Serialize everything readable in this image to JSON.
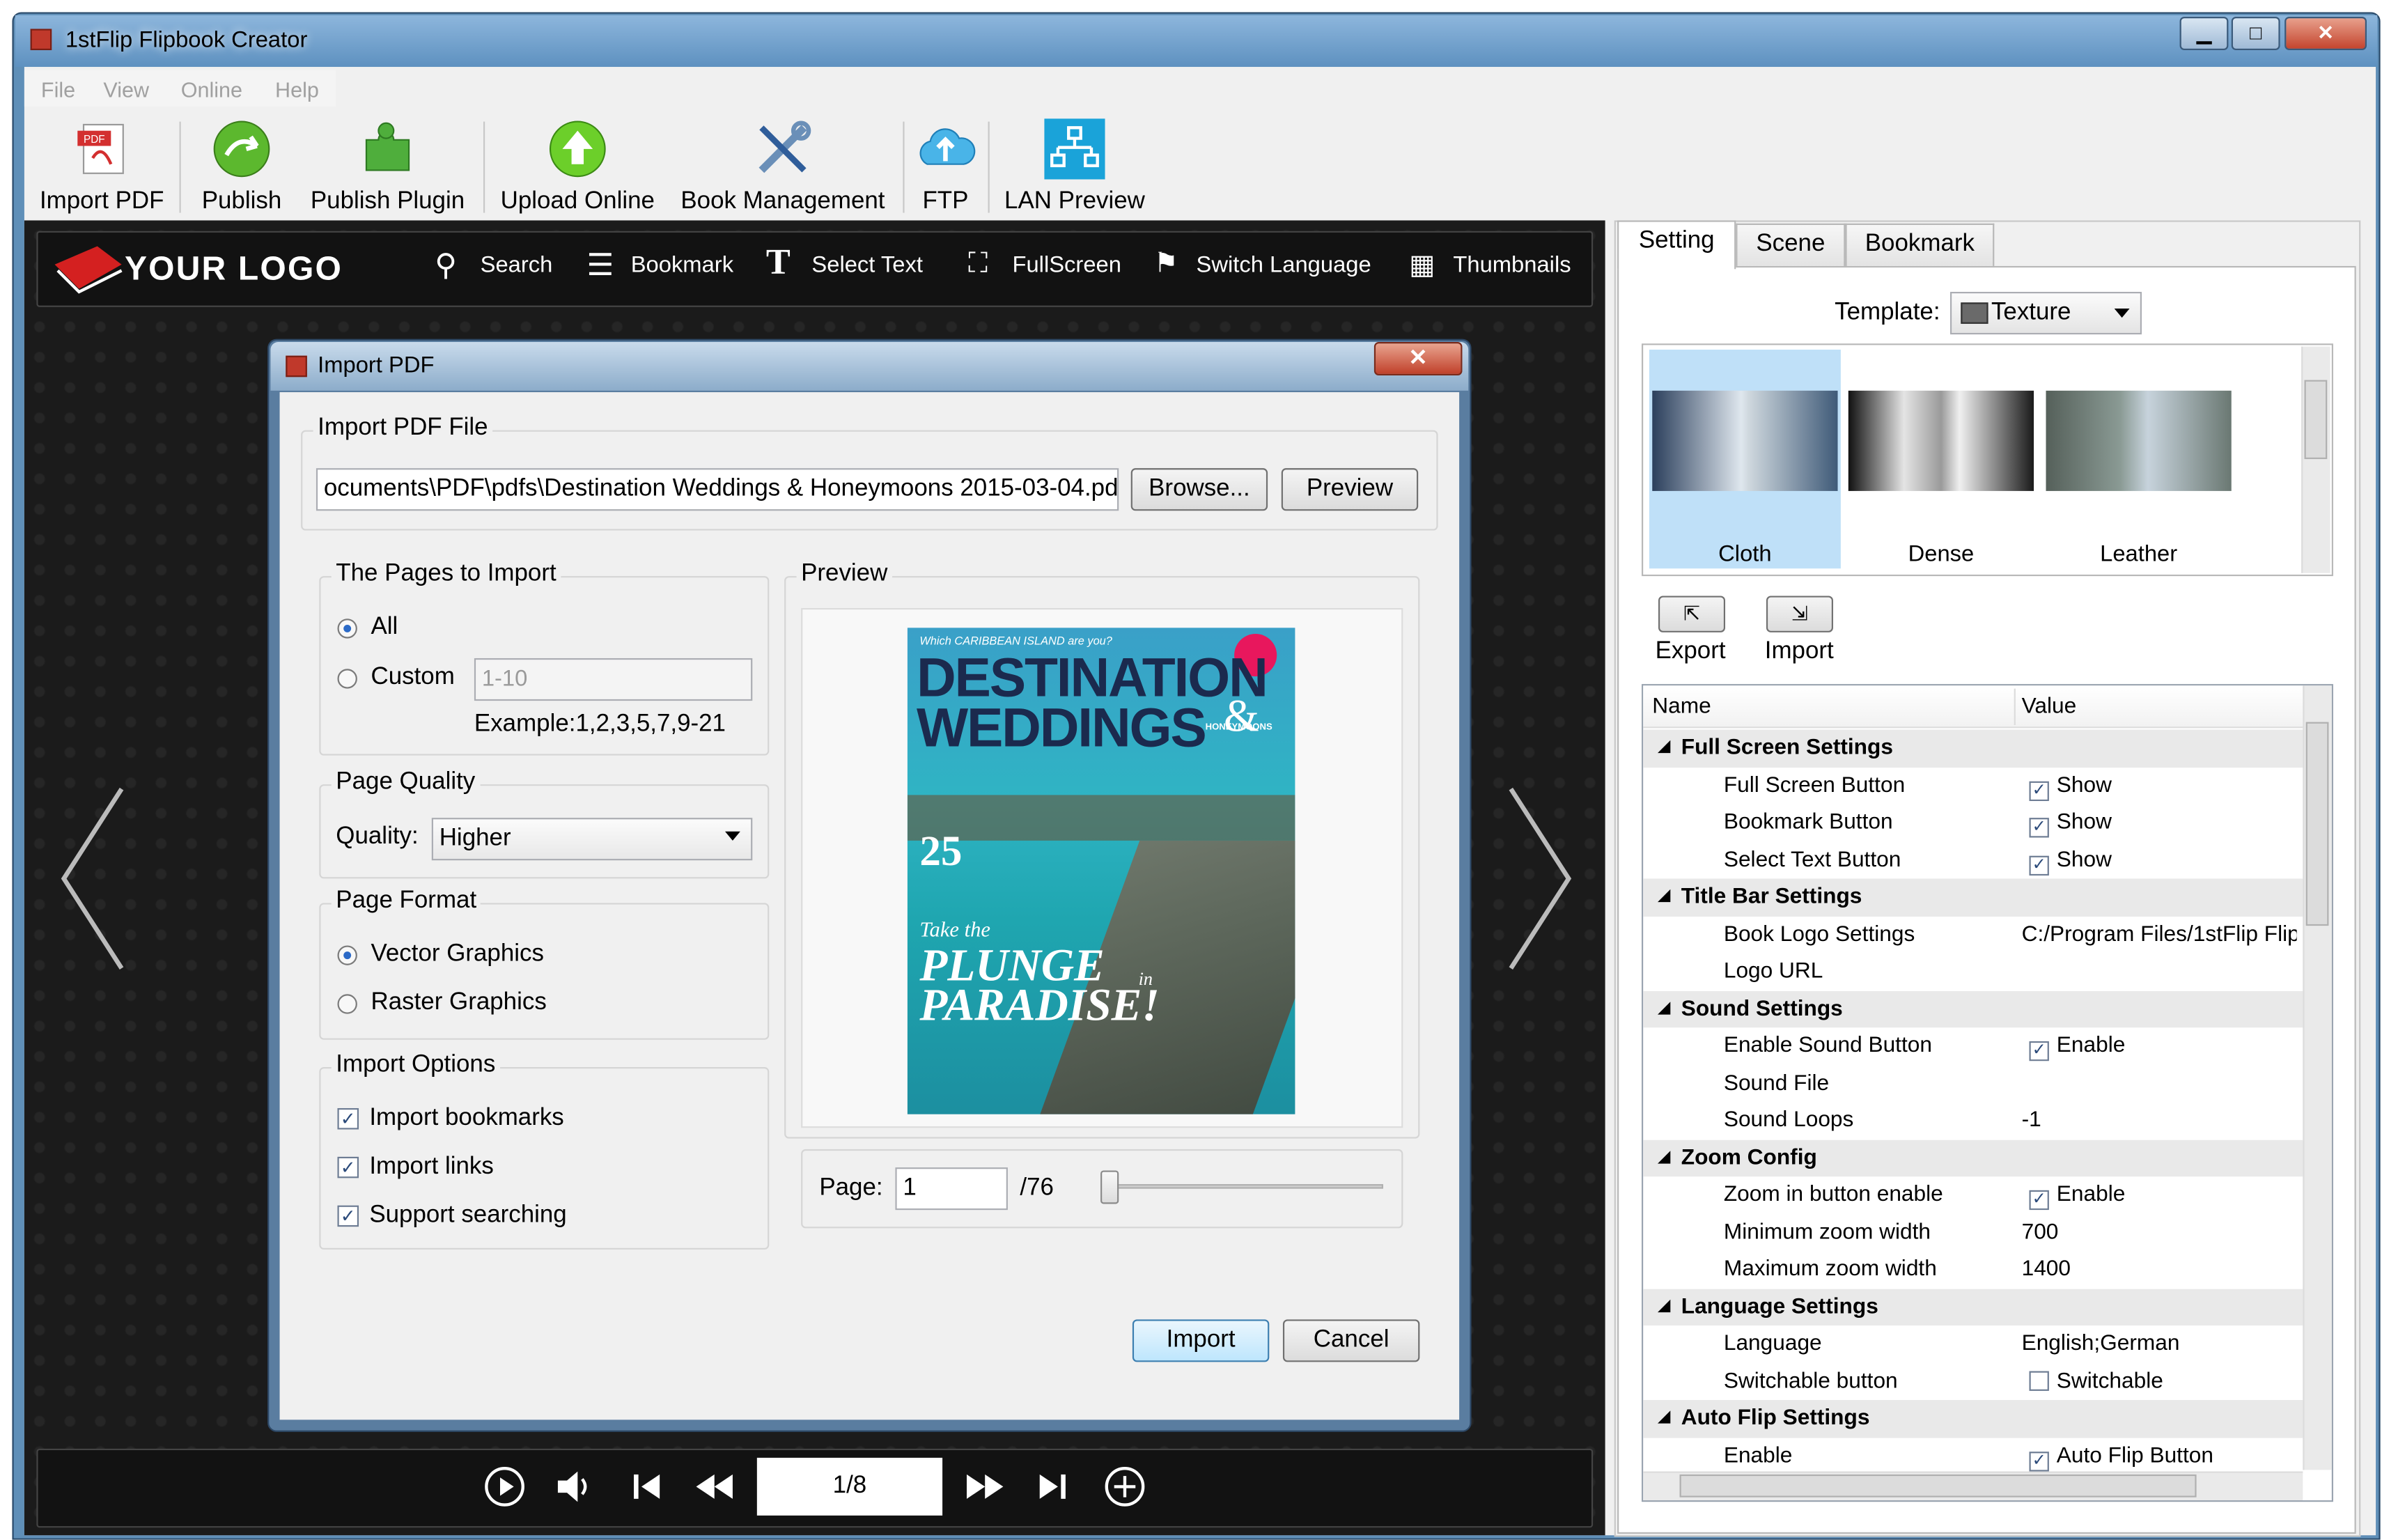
{
  "window": {
    "title": "1stFlip Flipbook Creator",
    "min": "▁",
    "max": "□",
    "close": "✕"
  },
  "menu": [
    "File",
    "View",
    "Online",
    "Help"
  ],
  "toolbar": [
    {
      "label": "Import PDF",
      "icon": "pdf-icon"
    },
    {
      "label": "Publish",
      "icon": "publish-icon"
    },
    {
      "label": "Publish Plugin",
      "icon": "plugin-icon"
    },
    {
      "label": "Upload Online",
      "icon": "upload-icon"
    },
    {
      "label": "Book Management",
      "icon": "tools-icon"
    },
    {
      "label": "FTP",
      "icon": "cloud-icon"
    },
    {
      "label": "LAN Preview",
      "icon": "network-icon"
    }
  ],
  "book_toolbar": {
    "logo": "YOUR LOGO",
    "items": [
      "Search",
      "Bookmark",
      "Select Text",
      "FullScreen",
      "Switch Language",
      "Thumbnails"
    ]
  },
  "book_bottom": {
    "page": "1/8"
  },
  "dialog": {
    "title": "Import PDF",
    "close": "✕",
    "file_group": "Import PDF File",
    "file_path": "ocuments\\PDF\\pdfs\\Destination Weddings & Honeymoons 2015-03-04.pdf",
    "browse": "Browse...",
    "preview_btn": "Preview",
    "pages_group": "The Pages to Import",
    "all": "All",
    "custom": "Custom",
    "custom_value": "1-10",
    "example": "Example:1,2,3,5,7,9-21",
    "quality_group": "Page Quality",
    "quality_label": "Quality:",
    "quality_value": "Higher",
    "format_group": "Page Format",
    "vector": "Vector Graphics",
    "raster": "Raster Graphics",
    "options_group": "Import Options",
    "opt_bookmarks": "Import bookmarks",
    "opt_links": "Import links",
    "opt_search": "Support searching",
    "preview_group": "Preview",
    "cover": {
      "top": "Which CARIBBEAN ISLAND are you?",
      "line1": "DESTINATION",
      "line2": "WEDDINGS",
      "amp": "&",
      "honey": "HONEYMOONS",
      "num": "25",
      "take": "Take the",
      "plunge": "PLUNGE",
      "in": "in",
      "paradise": "PARADISE!"
    },
    "page_label": "Page:",
    "page_value": "1",
    "page_total": "/76",
    "import": "Import",
    "cancel": "Cancel"
  },
  "panel": {
    "tabs": [
      "Setting",
      "Scene",
      "Bookmark"
    ],
    "template_label": "Template:",
    "template_value": "Texture",
    "thumbs": [
      "Cloth",
      "Dense",
      "Leather"
    ],
    "export": "Export",
    "import": "Import",
    "col_name": "Name",
    "col_value": "Value",
    "rows": [
      {
        "cat": true,
        "name": "Full Screen Settings"
      },
      {
        "name": "Full Screen Button",
        "check": true,
        "value": "Show"
      },
      {
        "name": "Bookmark Button",
        "check": true,
        "value": "Show"
      },
      {
        "name": "Select Text Button",
        "check": true,
        "value": "Show"
      },
      {
        "cat": true,
        "name": "Title Bar Settings"
      },
      {
        "name": "Book Logo Settings",
        "value": "C:/Program Files/1stFlip Flip"
      },
      {
        "name": "Logo URL",
        "value": ""
      },
      {
        "cat": true,
        "name": "Sound Settings"
      },
      {
        "name": "Enable Sound Button",
        "check": true,
        "value": "Enable"
      },
      {
        "name": "Sound File",
        "value": ""
      },
      {
        "name": "Sound Loops",
        "value": "-1"
      },
      {
        "cat": true,
        "name": "Zoom Config"
      },
      {
        "name": "Zoom in button enable",
        "check": true,
        "value": "Enable"
      },
      {
        "name": "Minimum zoom width",
        "value": "700"
      },
      {
        "name": "Maximum zoom width",
        "value": "1400"
      },
      {
        "cat": true,
        "name": "Language Settings"
      },
      {
        "name": "Language",
        "value": "English;German"
      },
      {
        "name": "Switchable button",
        "check": false,
        "value": "Switchable"
      },
      {
        "cat": true,
        "name": "Auto Flip Settings"
      },
      {
        "name": "Enable",
        "check": true,
        "value": "Auto Flip Button"
      }
    ]
  }
}
